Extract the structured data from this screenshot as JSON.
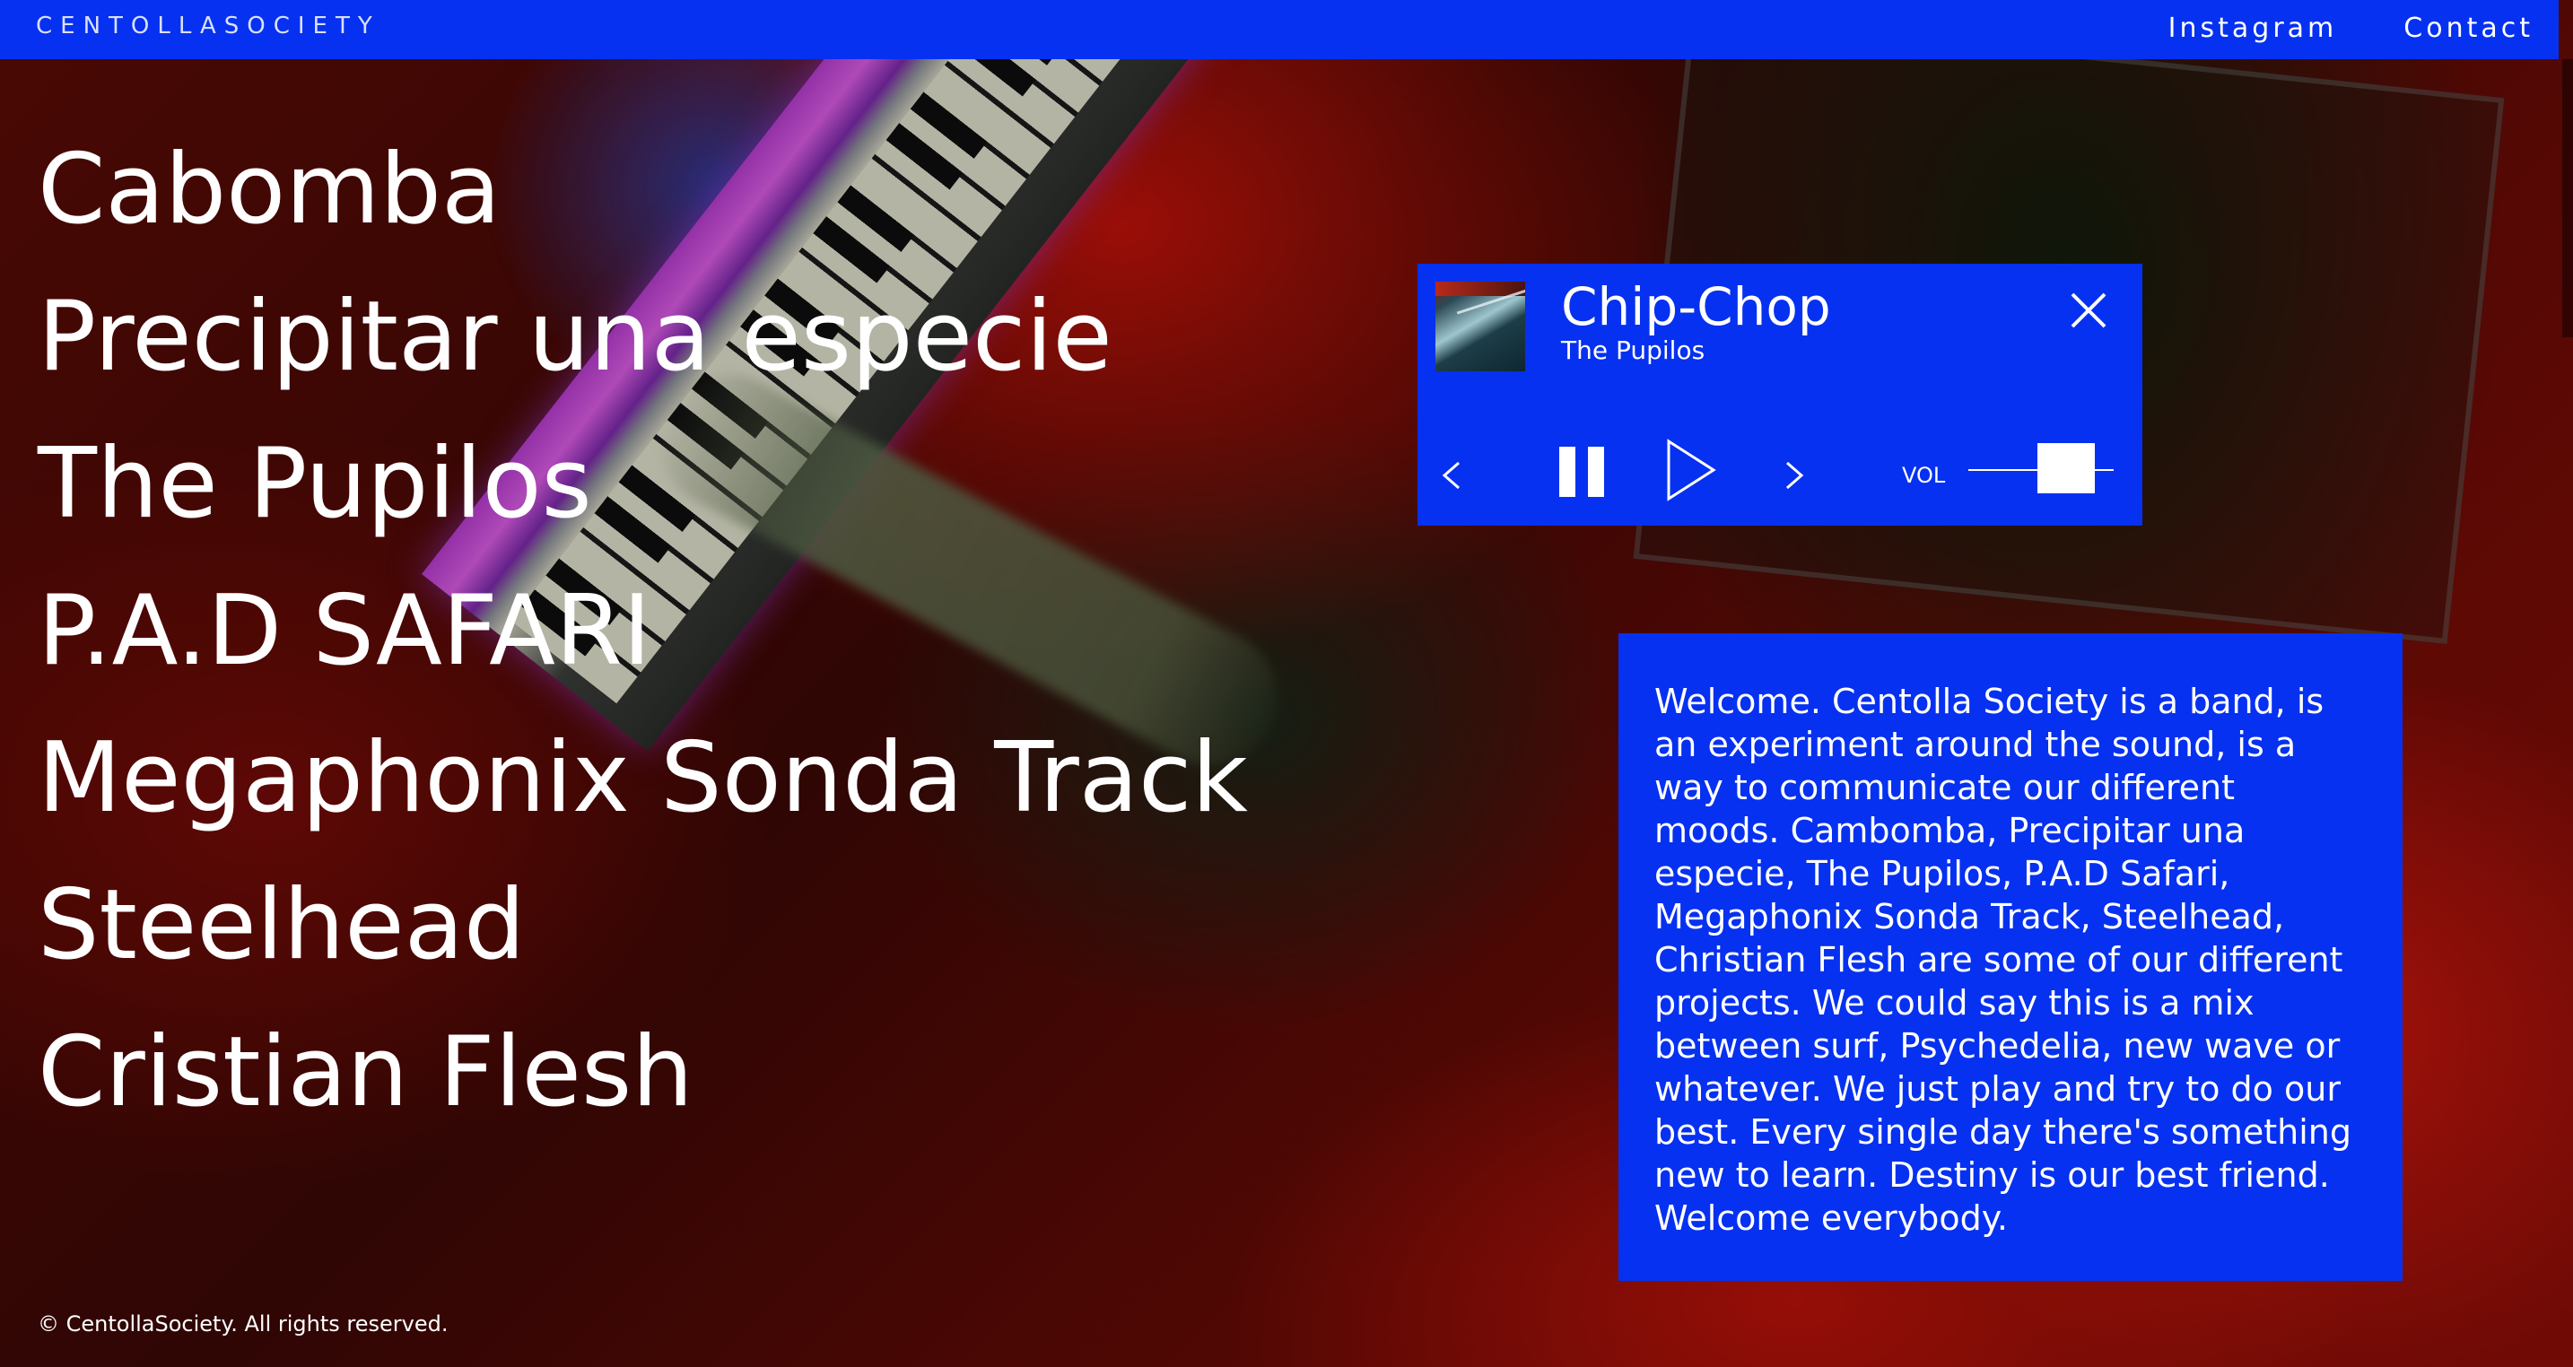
{
  "header": {
    "brand": "CENTOLLASOCIETY",
    "nav": [
      {
        "label": "Instagram"
      },
      {
        "label": "Contact"
      }
    ]
  },
  "projects": [
    "Cabomba",
    "Precipitar una especie",
    "The Pupilos",
    "P.A.D SAFARI",
    "Megaphonix Sonda Track",
    "Steelhead",
    "Cristian Flesh"
  ],
  "player": {
    "track_title": "Chip-Chop",
    "artist": "The Pupilos",
    "volume_label": "VOL",
    "volume_level": 0.67,
    "state": "playing"
  },
  "welcome": {
    "text": "Welcome. Centolla Society is a band, is an experiment around the sound, is a way to communicate our different moods. Cambomba, Precipitar una especie, The Pupilos, P.A.D Safari, Megaphonix Sonda Track, Steelhead, Christian Flesh are some of our different projects. We could say this is a mix between surf, Psychedelia, new wave or whatever. We just play and try to do our best. Every single day there's something new to learn. Destiny is our best friend. Welcome everybody."
  },
  "footer": {
    "copyright": "© CentollaSociety. All rights reserved."
  },
  "colors": {
    "accent_blue": "#0631f0",
    "text": "#ffffff"
  },
  "icons": {
    "close": "close-icon",
    "previous": "chevron-left-icon",
    "pause": "pause-icon",
    "play": "play-icon",
    "next": "chevron-right-icon"
  }
}
